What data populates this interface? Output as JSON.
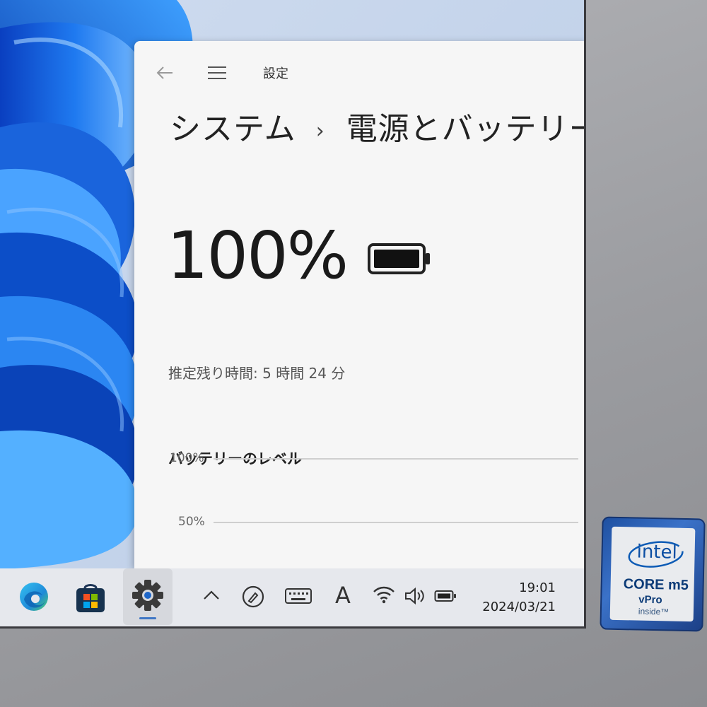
{
  "settings": {
    "app_title": "設定",
    "breadcrumb": {
      "parent": "システム",
      "separator": "›",
      "current": "電源とバッテリー"
    },
    "battery": {
      "percent_text": "100%",
      "charge_fraction": 1.0,
      "remaining_label": "推定残り時間:",
      "remaining_value": "5 時間 24 分"
    },
    "battery_level": {
      "heading": "バッテリーのレベル",
      "gridlines": [
        "100%",
        "50%"
      ]
    }
  },
  "taskbar": {
    "apps": [
      "edge-icon",
      "store-icon",
      "settings-icon"
    ],
    "tray": [
      "chevron-up-icon",
      "pen-icon",
      "touch-keyboard-icon",
      "ime-icon",
      "wifi-icon",
      "volume-icon",
      "battery-icon"
    ],
    "ime_glyph": "A",
    "clock_time": "19:01",
    "clock_date": "2024/03/21"
  },
  "sticker": {
    "brand": "intel",
    "line1": "CORE m5",
    "line2": "vPro",
    "line3": "inside™"
  },
  "colors": {
    "wallpaper_blue": "#1f6fe0",
    "accent": "#3e76c5",
    "intel_blue": "#1d4fa0"
  }
}
